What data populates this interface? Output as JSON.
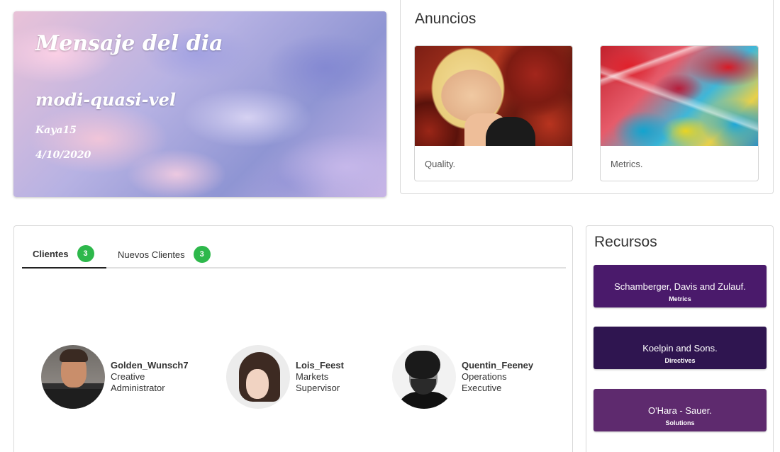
{
  "motd": {
    "title": "Mensaje del dia",
    "message": "modi-quasi-vel",
    "author": "Kaya15",
    "date": "4/10/2020"
  },
  "anuncios": {
    "title": "Anuncios",
    "cards": [
      {
        "caption": "Quality."
      },
      {
        "caption": "Metrics."
      }
    ]
  },
  "clientes": {
    "tabs": [
      {
        "label": "Clientes",
        "count": "3",
        "active": true
      },
      {
        "label": "Nuevos Clientes",
        "count": "3",
        "active": false
      }
    ],
    "people": [
      {
        "name": "Golden_Wunsch7",
        "role_line1": "Creative",
        "role_line2": "Administrator"
      },
      {
        "name": "Lois_Feest",
        "role_line1": "Markets",
        "role_line2": "Supervisor"
      },
      {
        "name": "Quentin_Feeney",
        "role_line1": "Operations",
        "role_line2": "Executive"
      }
    ],
    "badge_color": "#2db84b"
  },
  "recursos": {
    "title": "Recursos",
    "items": [
      {
        "title": "Schamberger, Davis and Zulauf.",
        "subtitle": "Metrics",
        "color": "#4a1a6b"
      },
      {
        "title": "Koelpin and Sons.",
        "subtitle": "Directives",
        "color": "#2f1550"
      },
      {
        "title": "O'Hara - Sauer.",
        "subtitle": "Solutions",
        "color": "#5e2a6e"
      }
    ]
  }
}
